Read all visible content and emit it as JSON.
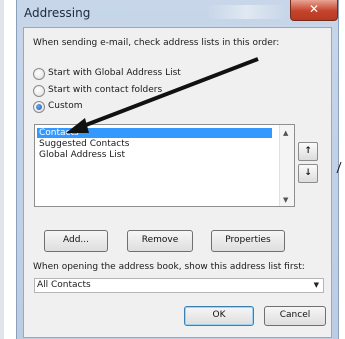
{
  "window": {
    "title": "Addressing",
    "close_glyph": "✕"
  },
  "order_prompt": "When sending e-mail, check address lists in this order:",
  "options": {
    "global_label": "Start with Global Address List",
    "contact_label": "Start with contact folders",
    "custom_label": "Custom",
    "selected": "Custom"
  },
  "address_lists": {
    "items": [
      "Contacts",
      "Suggested Contacts",
      "Global Address List"
    ],
    "selected": "Contacts"
  },
  "side_buttons": {
    "up_glyph": "↑",
    "down_glyph": "↓"
  },
  "buttons": {
    "add": "Add...",
    "remove": "Remove",
    "properties": "Properties",
    "ok": "OK",
    "cancel": "Cancel"
  },
  "open_prompt": "When opening the address book, show this address list first:",
  "open_list": {
    "value": "All Contacts"
  },
  "colors": {
    "selection": "#3399ff",
    "close_button": "#c5442b",
    "annotation_arrow": "#111111"
  },
  "icons": {
    "radio_selected": "radio-on-icon",
    "radio_unselected": "radio-off-icon",
    "move_up": "arrow-up-icon",
    "move_down": "arrow-down-icon",
    "dropdown": "chevron-down-icon"
  }
}
